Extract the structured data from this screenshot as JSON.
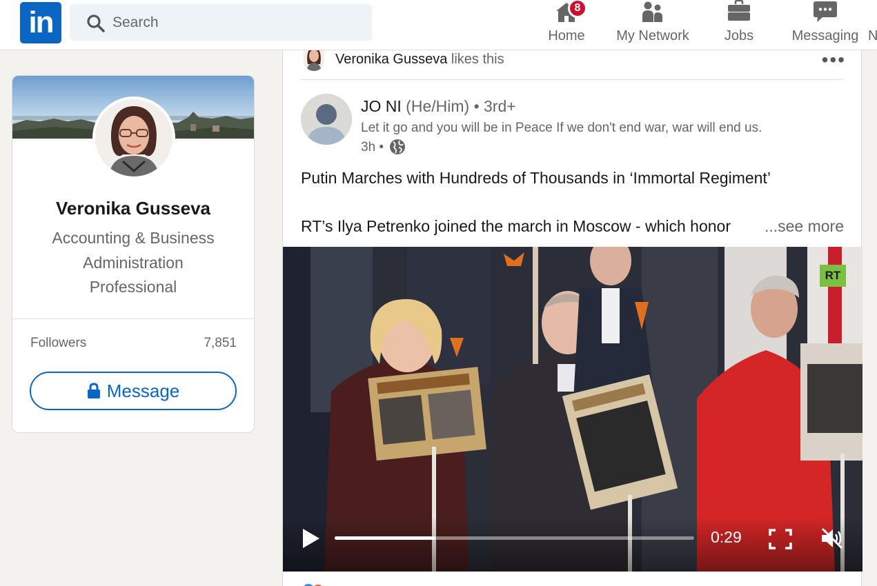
{
  "nav": {
    "search_placeholder": "Search",
    "items": [
      {
        "label": "Home",
        "icon": "home-icon",
        "badge": "8"
      },
      {
        "label": "My Network",
        "icon": "network-icon"
      },
      {
        "label": "Jobs",
        "icon": "briefcase-icon"
      },
      {
        "label": "Messaging",
        "icon": "messaging-icon"
      },
      {
        "label": "N",
        "icon": ""
      }
    ]
  },
  "profile": {
    "name": "Veronika Gusseva",
    "headline": "Accounting & Business Administration Professional",
    "followers_label": "Followers",
    "followers_count": "7,851",
    "message_label": "Message"
  },
  "post": {
    "social_actor": "Veronika Gusseva",
    "social_action": "likes this",
    "author_name": "JO NI",
    "author_pronouns": "(He/Him)",
    "author_degree": "• 3rd+",
    "author_tagline": "Let it go and you will be in Peace If we don't end war, war will end us.",
    "time": "3h •",
    "title": "Putin Marches with Hundreds of Thousands in ‘Immortal Regiment’",
    "body": "RT’s Ilya Petrenko joined the march in Moscow - which honor",
    "see_more": "...see more",
    "video": {
      "watermark": "RT",
      "current_time": "0:29",
      "progress": 0.28,
      "muted": true
    }
  },
  "colors": {
    "brand": "#0a66c2",
    "badge": "#cb112d",
    "rt_green": "#7bc043"
  }
}
